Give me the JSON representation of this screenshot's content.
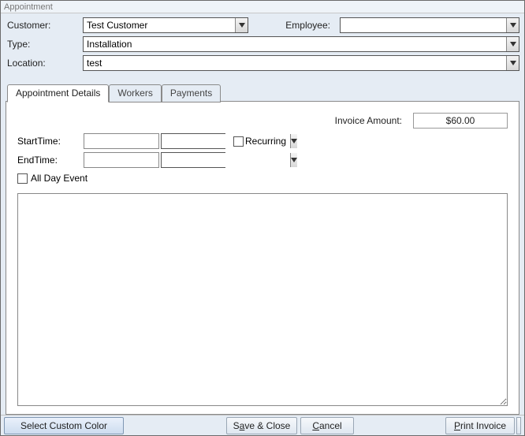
{
  "window": {
    "title": "Appointment"
  },
  "header": {
    "customer_label": "Customer:",
    "customer_value": "Test Customer",
    "employee_label": "Employee:",
    "employee_value": "",
    "type_label": "Type:",
    "type_value": "Installation",
    "location_label": "Location:",
    "location_value": "test"
  },
  "tabs": {
    "details": "Appointment Details",
    "workers": "Workers",
    "payments": "Payments"
  },
  "details": {
    "invoice_label": "Invoice Amount:",
    "invoice_value": "$60.00",
    "start_label": "StartTime:",
    "start_date": "",
    "start_time": "",
    "end_label": "EndTime:",
    "end_date": "",
    "end_time": "",
    "recurring_label": "Recurring",
    "allday_label": "All Day Event",
    "memo": ""
  },
  "buttons": {
    "select_color": "Select Custom Color",
    "save_close_pre": "S",
    "save_close_u": "a",
    "save_close_post": "ve & Close",
    "cancel_u": "C",
    "cancel_post": "ancel",
    "print_u": "P",
    "print_post": "rint Invoice"
  }
}
